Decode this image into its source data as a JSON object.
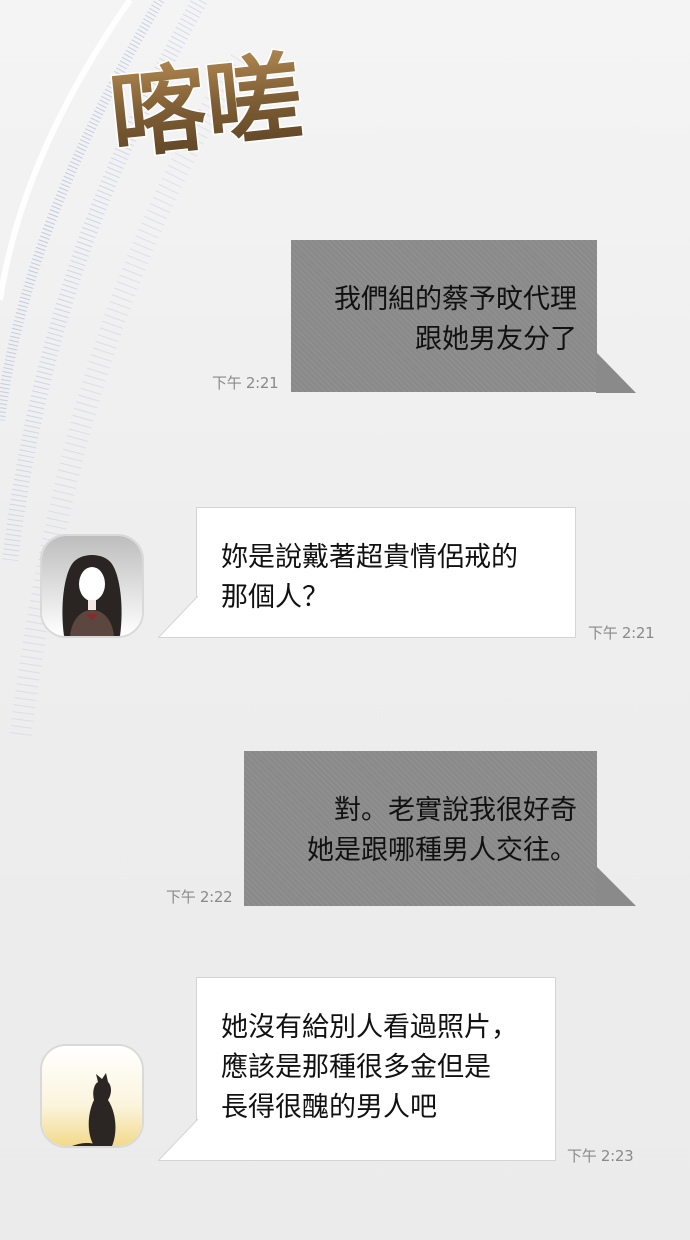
{
  "sfx_text": "喀嗟",
  "messages": [
    {
      "side": "right",
      "lines": [
        "我們組的蔡予旼代理",
        "跟她男友分了"
      ],
      "time": "下午 2:21"
    },
    {
      "side": "left",
      "avatar": "woman-avatar",
      "lines": [
        "妳是說戴著超貴情侶戒的",
        "那個人？"
      ],
      "time": "下午 2:21"
    },
    {
      "side": "right",
      "lines": [
        "對。老實說我很好奇",
        "她是跟哪種男人交往。"
      ],
      "time": "下午 2:22"
    },
    {
      "side": "left",
      "avatar": "cat-avatar",
      "lines": [
        "她沒有給別人看過照片，",
        "應該是那種很多金但是",
        "長得很醜的男人吧"
      ],
      "time": "下午 2:23"
    }
  ],
  "colors": {
    "right_bubble": "#8a8a8a",
    "left_bubble": "#ffffff",
    "sfx_gold": "#8a6a3c",
    "speckle_blue": "#5a6fb8"
  }
}
